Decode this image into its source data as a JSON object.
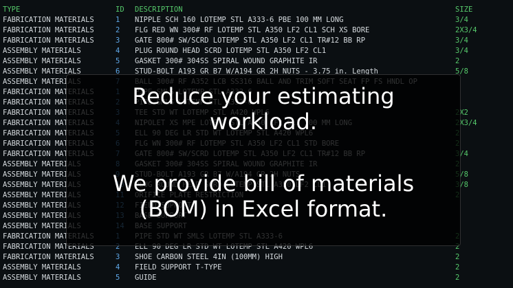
{
  "columns": {
    "type": "TYPE",
    "id": "ID",
    "description": "DESCRIPTION",
    "size": "SIZE"
  },
  "rows": [
    {
      "type": "FABRICATION MATERIALS",
      "id": "1",
      "description": "NIPPLE SCH 160 LOTEMP STL A333-6 PBE 100 MM LONG",
      "size": "3/4"
    },
    {
      "type": "FABRICATION MATERIALS",
      "id": "2",
      "description": "FLG RED WN 300# RF LOTEMP STL A350 LF2 CL1 SCH XS BORE",
      "size": "2X3/4"
    },
    {
      "type": "FABRICATION MATERIALS",
      "id": "3",
      "description": "GATE 800# SW/SCRD LOTEMP STL A350 LF2 CL1 TR#12 BB RP",
      "size": "3/4"
    },
    {
      "type": "ASSEMBLY MATERIALS",
      "id": "4",
      "description": "PLUG ROUND HEAD SCRD LOTEMP STL A350 LF2 CL1",
      "size": "3/4"
    },
    {
      "type": "ASSEMBLY MATERIALS",
      "id": "5",
      "description": "GASKET 300# 304SS SPIRAL WOUND GRAPHITE IR",
      "size": "2"
    },
    {
      "type": "ASSEMBLY MATERIALS",
      "id": "6",
      "description": "STUD-BOLT A193 GR B7 W/A194 GR 2H NUTS - 3.75 in. Length",
      "size": "5/8"
    },
    {
      "type": "ASSEMBLY MATERIALS",
      "id": "7",
      "description": "BALL 300# RF A352 LCB SS316 BALL AND TRIM SOFT SEAT FP FS HNDL OP",
      "size": ""
    },
    {
      "type": "FABRICATION MATERIALS",
      "id": "1",
      "description": "PIPE SMLS LOTEMP STL A333-6",
      "size": ""
    },
    {
      "type": "FABRICATION MATERIALS",
      "id": "2",
      "description": "PIPE SMLS LOTEMP STL A333-6",
      "size": ""
    },
    {
      "type": "FABRICATION MATERIALS",
      "id": "3",
      "description": "TEE STD WT LOTEMP STL A420 WPL6",
      "size": "2X2"
    },
    {
      "type": "FABRICATION MATERIALS",
      "id": "4",
      "description": "NIPOLET XS MPE LOTEMP STL A350 LF2 CL1 100 MM LONG",
      "size": "2X3/4"
    },
    {
      "type": "FABRICATION MATERIALS",
      "id": "5",
      "description": "ELL 90 DEG LR STD WT LOTEMP STL A420 WPL6",
      "size": "2"
    },
    {
      "type": "FABRICATION MATERIALS",
      "id": "6",
      "description": "FLG WN 300# RF LOTEMP STL A350 LF2 CL1 STD BORE",
      "size": "2"
    },
    {
      "type": "FABRICATION MATERIALS",
      "id": "7",
      "description": "GATE 800# SW/SCRD LOTEMP STL A350 LF2 CL1 TR#12 BB RP",
      "size": "3/4"
    },
    {
      "type": "ASSEMBLY MATERIALS",
      "id": "8",
      "description": "GASKET 300# 304SS SPIRAL WOUND GRAPHITE IR",
      "size": "2"
    },
    {
      "type": "ASSEMBLY MATERIALS",
      "id": "9",
      "description": "STUD-BOLT A193 GR B7 W/A194 GR 2H NUTS",
      "size": "5/8"
    },
    {
      "type": "ASSEMBLY MATERIALS",
      "id": "10",
      "description": "PLUG ROUND HEAD SCRD LOTEMP STL A350 LF2 CL1",
      "size": "3/8"
    },
    {
      "type": "ASSEMBLY MATERIALS",
      "id": "11",
      "description": "ORIFICE PLATE RESTRICTION",
      "size": "2"
    },
    {
      "type": "ASSEMBLY MATERIALS",
      "id": "12",
      "description": "FIELD SUPPORT",
      "size": ""
    },
    {
      "type": "ASSEMBLY MATERIALS",
      "id": "13",
      "description": "BASE SUPPORT",
      "size": ""
    },
    {
      "type": "ASSEMBLY MATERIALS",
      "id": "14",
      "description": "BASE SUPPORT",
      "size": ""
    },
    {
      "type": "FABRICATION MATERIALS",
      "id": "1",
      "description": "PIPE STD WT SMLS LOTEMP STL A333-6",
      "size": "2"
    },
    {
      "type": "FABRICATION MATERIALS",
      "id": "2",
      "description": "ELL 90 DEG LR STD WT LOTEMP STL A420 WPL6",
      "size": "2"
    },
    {
      "type": "FABRICATION MATERIALS",
      "id": "3",
      "description": "SHOE CARBON STEEL 4IN (100MM) HIGH",
      "size": "2"
    },
    {
      "type": "ASSEMBLY MATERIALS",
      "id": "4",
      "description": "FIELD SUPPORT T-TYPE",
      "size": "2"
    },
    {
      "type": "ASSEMBLY MATERIALS",
      "id": "5",
      "description": "GUIDE",
      "size": "2"
    }
  ],
  "overlay": {
    "line1": "Reduce your estimating",
    "line2": "workload.",
    "line3": "We provide bill of materials",
    "line4": "(BOM) in Excel format."
  }
}
